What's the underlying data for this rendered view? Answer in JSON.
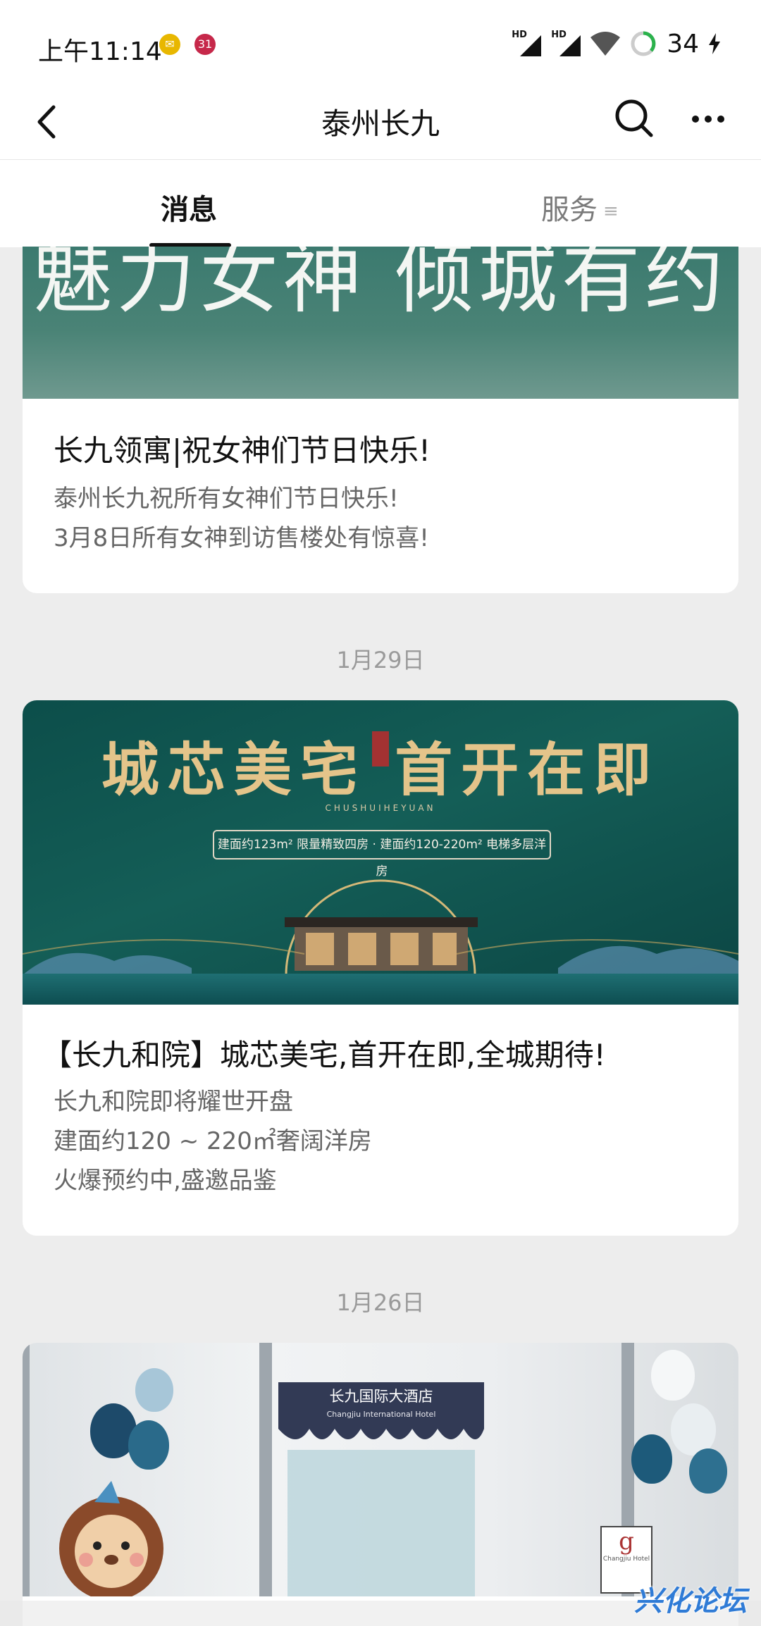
{
  "status_bar": {
    "time": "上午11:14",
    "mail_badge_color": "#e8b700",
    "notif_badge": "31",
    "notif_badge_color": "#c6284a",
    "signal_1": "HD",
    "signal_2": "HD",
    "battery": "34"
  },
  "header": {
    "title": "泰州长九",
    "back_icon": "chevron-left-icon",
    "search_icon": "search-icon",
    "more_icon": "more-horizontal-icon"
  },
  "tabs": [
    {
      "label": "消息",
      "active": true
    },
    {
      "label": "服务",
      "active": false
    }
  ],
  "feed": {
    "posts": [
      {
        "banner_text": "魅力女神 倾城有约",
        "title": "长九领寓|祝女神们节日快乐!",
        "desc_lines": [
          "泰州长九祝所有女神们节日快乐!",
          "3月8日所有女神到访售楼处有惊喜!"
        ]
      },
      {
        "date": "1月29日",
        "banner_heading": "城芯美宅 首开在即",
        "banner_sub": "CHUSHUIHEYUAN",
        "banner_pill": "建面约123m² 限量精致四房 · 建面约120-220m² 电梯多层洋房",
        "title": "【长九和院】城芯美宅,首开在即,全城期待!",
        "desc_lines": [
          "长九和院即将耀世开盘",
          "建面约120 ~ 220㎡奢阔洋房",
          "火爆预约中,盛邀品鉴"
        ]
      },
      {
        "date": "1月26日",
        "awning_cn": "长九国际大酒店",
        "awning_en": "Changjiu International Hotel",
        "cart_sign": "g",
        "cart_sign_label": "Changjiu Hotel"
      }
    ]
  },
  "watermark": "兴化论坛",
  "colors": {
    "teal_banner": "#145e57",
    "gold_text": "#e4c48a",
    "accent_watermark": "#2f7bd6"
  }
}
